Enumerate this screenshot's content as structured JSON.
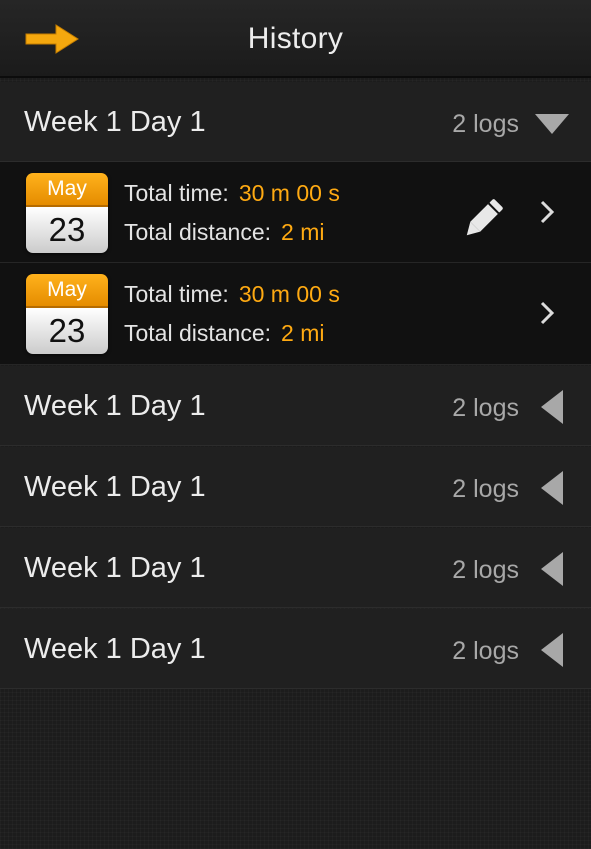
{
  "navbar": {
    "title": "History",
    "back_icon": "arrow-right-icon"
  },
  "groups": [
    {
      "title": "Week 1 Day 1",
      "count": "2 logs",
      "state": "expanded",
      "logs": [
        {
          "month": "May",
          "day": "23",
          "time_label": "Total time:",
          "time_value": "30 m 00 s",
          "distance_label": "Total distance:",
          "distance_value": "2 mi",
          "editable": true
        },
        {
          "month": "May",
          "day": "23",
          "time_label": "Total time:",
          "time_value": "30 m 00 s",
          "distance_label": "Total distance:",
          "distance_value": "2 mi",
          "editable": false
        }
      ]
    },
    {
      "title": "Week 1 Day 1",
      "count": "2 logs",
      "state": "collapsed"
    },
    {
      "title": "Week 1 Day 1",
      "count": "2 logs",
      "state": "collapsed"
    },
    {
      "title": "Week 1 Day 1",
      "count": "2 logs",
      "state": "collapsed"
    },
    {
      "title": "Week 1 Day 1",
      "count": "2 logs",
      "state": "collapsed"
    }
  ],
  "colors": {
    "accent": "#ffaa12",
    "background": "#1c1c1c",
    "log_background": "#111111",
    "text": "#e6e6e6",
    "muted": "#a8a8a8"
  }
}
